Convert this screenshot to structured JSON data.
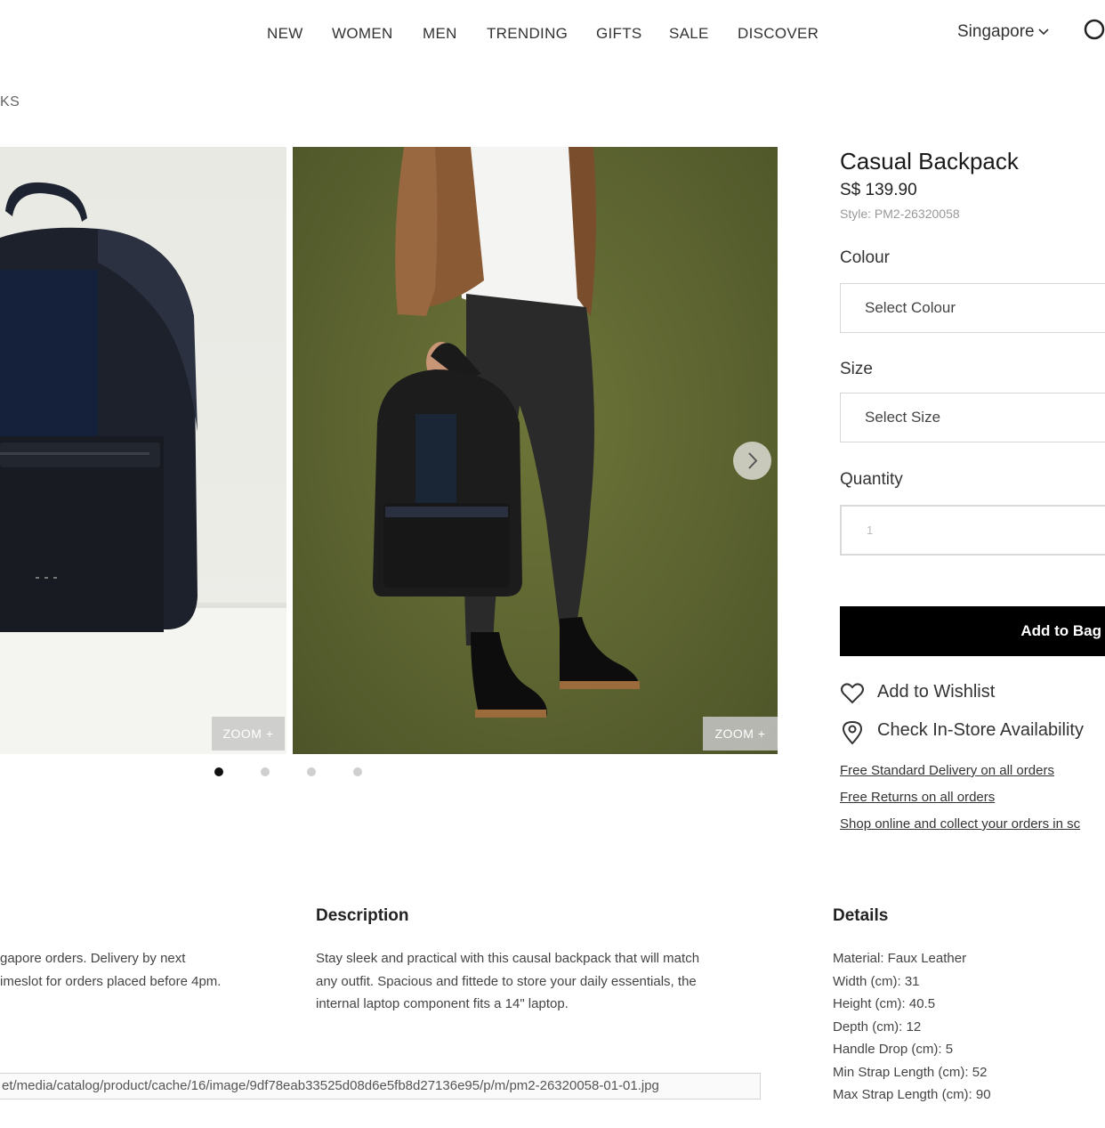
{
  "nav": {
    "items": [
      "NEW",
      "WOMEN",
      "MEN",
      "TRENDING",
      "GIFTS",
      "SALE",
      "DISCOVER"
    ],
    "region": "Singapore"
  },
  "breadcrumb": "KS",
  "gallery": {
    "zoom_label": "ZOOM +",
    "dots_total": 4,
    "active_dot": 1
  },
  "product": {
    "title": "Casual Backpack",
    "price": "S$ 139.90",
    "style": "Style: PM2-26320058",
    "colour_label": "Colour",
    "colour_placeholder": "Select Colour",
    "size_label": "Size",
    "size_placeholder": "Select Size",
    "quantity_label": "Quantity",
    "quantity_value": "1",
    "add_to_bag": "Add to Bag",
    "wishlist": "Add to Wishlist",
    "store_availability": "Check In-Store Availability",
    "policies": [
      "Free Standard Delivery on all orders",
      "Free Returns on all orders",
      "Shop online and collect your orders in sc"
    ]
  },
  "info": {
    "delivery_text": [
      "gapore orders. Delivery by next",
      "imeslot for orders placed before 4pm."
    ],
    "description_heading": "Description",
    "description_text": [
      "Stay sleek and practical with this causal backpack that will match",
      "any outfit. Spacious and fittede to store your daily essentials, the",
      "internal laptop component fits a 14\" laptop."
    ],
    "details_heading": "Details",
    "details": [
      "Material: Faux Leather",
      "Width (cm): 31",
      "Height (cm): 40.5",
      "Depth (cm): 12",
      "Handle Drop (cm): 5",
      "Min Strap Length (cm): 52",
      "Max Strap Length (cm): 90"
    ]
  },
  "status_url": "et/media/catalog/product/cache/16/image/9df78eab33525d08d6e5fb8d27136e95/p/m/pm2-26320058-01-01.jpg",
  "colors": {
    "nav_text": "#333333",
    "button_bg": "#000000",
    "photo_bg_olive": "#5b6230",
    "photo_bg_light": "#ecece7"
  }
}
